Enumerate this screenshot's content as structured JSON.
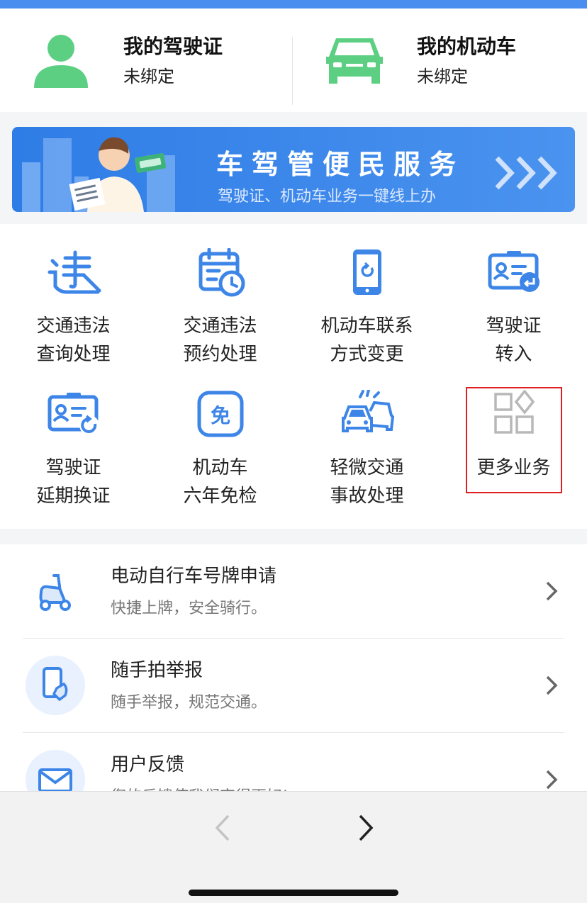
{
  "header": {
    "license": {
      "title": "我的驾驶证",
      "status": "未绑定",
      "icon": "person-icon"
    },
    "vehicle": {
      "title": "我的机动车",
      "status": "未绑定",
      "icon": "car-icon"
    }
  },
  "banner": {
    "title": "车驾管便民服务",
    "subtitle": "驾驶证、机动车业务一键线上办"
  },
  "services": [
    {
      "line1": "交通违法",
      "line2": "查询处理",
      "icon": "violation-icon"
    },
    {
      "line1": "交通违法",
      "line2": "预约处理",
      "icon": "calendar-clock-icon"
    },
    {
      "line1": "机动车联系",
      "line2": "方式变更",
      "icon": "phone-refresh-icon"
    },
    {
      "line1": "驾驶证",
      "line2": "转入",
      "icon": "license-transfer-icon"
    },
    {
      "line1": "驾驶证",
      "line2": "延期换证",
      "icon": "license-renew-icon"
    },
    {
      "line1": "机动车",
      "line2": "六年免检",
      "icon": "exempt-icon"
    },
    {
      "line1": "轻微交通",
      "line2": "事故处理",
      "icon": "car-accident-icon"
    },
    {
      "line1": "更多业务",
      "line2": "",
      "icon": "more-grid-icon"
    }
  ],
  "list": [
    {
      "title": "电动自行车号牌申请",
      "subtitle": "快捷上牌，安全骑行。",
      "icon": "scooter-icon"
    },
    {
      "title": "随手拍举报",
      "subtitle": "随手举报，规范交通。",
      "icon": "phone-report-icon"
    },
    {
      "title": "用户反馈",
      "subtitle": "您的反馈使我们变得更好!",
      "icon": "mail-icon"
    }
  ],
  "colors": {
    "accent": "#3d86e8",
    "green": "#5ccf82",
    "highlight": "#e02020"
  }
}
